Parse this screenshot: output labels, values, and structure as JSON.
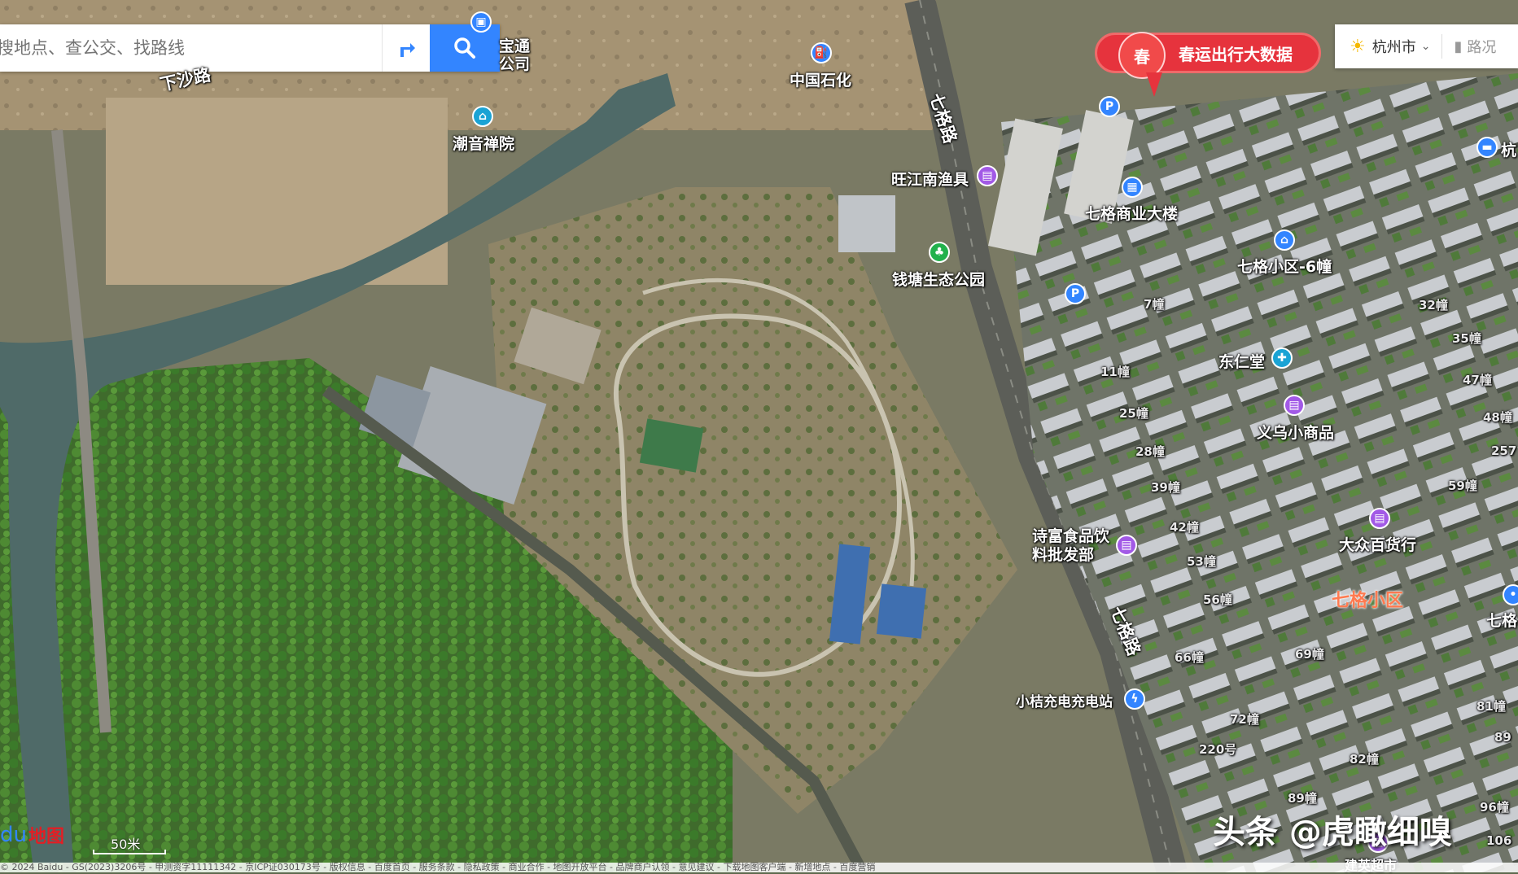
{
  "search": {
    "placeholder": "搜地点、查公交、找路线"
  },
  "banner": {
    "seal": "春",
    "text": "春运出行大数据"
  },
  "citybox": {
    "city": "杭州市",
    "traffic": "路况"
  },
  "roads": [
    {
      "name": "下沙路"
    },
    {
      "name": "七格路"
    },
    {
      "name": "七格路"
    }
  ],
  "pois": [
    {
      "name": "宝通公司",
      "icon": "bus-icon",
      "color": "#3385ff"
    },
    {
      "name": "中国石化",
      "icon": "gas-station-icon",
      "color": "#3385ff"
    },
    {
      "name": "潮音禅院",
      "icon": "temple-icon",
      "color": "#1aa3d4"
    },
    {
      "name": "旺江南渔具",
      "icon": "shop-icon",
      "color": "#a259e6"
    },
    {
      "name": "七格商业大楼",
      "icon": "building-icon",
      "color": "#3385ff"
    },
    {
      "name": "钱塘生态公园",
      "icon": "park-icon",
      "color": "#22b14c"
    },
    {
      "name": "七格小区-6幢",
      "icon": "residence-icon",
      "color": "#3385ff"
    },
    {
      "name": "东仁堂",
      "icon": "pharmacy-icon",
      "color": "#1aa3d4"
    },
    {
      "name": "义乌小商品",
      "icon": "shop-icon",
      "color": "#a259e6"
    },
    {
      "name": "大众百货行",
      "icon": "shop-icon",
      "color": "#a259e6"
    },
    {
      "name": "诗富食品饮料批发部",
      "icon": "shop-icon",
      "color": "#a259e6"
    },
    {
      "name": "小桔充电充电站",
      "icon": "charging-icon",
      "color": "#3385ff"
    },
    {
      "name": "杭",
      "icon": "hotel-icon",
      "color": "#3385ff"
    },
    {
      "name": "七格",
      "icon": "poi-icon",
      "color": "#3385ff"
    },
    {
      "name": "建英超市",
      "icon": "shop-icon",
      "color": "#a259e6"
    }
  ],
  "district": "七格小区",
  "buildings": [
    "7幢",
    "11幢",
    "25幢",
    "28幢",
    "39幢",
    "42幢",
    "53幢",
    "56幢",
    "66幢",
    "69幢",
    "72幢",
    "82幢",
    "89幢",
    "220号",
    "32幢",
    "35幢",
    "47幢",
    "48幢",
    "59幢",
    "81幢",
    "96幢",
    "106",
    "257",
    "89"
  ],
  "parking": [
    "P",
    "P"
  ],
  "scale": "50米",
  "logo": {
    "paw": "du",
    "text": "地图"
  },
  "footer": "© 2024 Baidu - GS(2023)3206号 - 甲测资字11111342 - 京ICP证030173号 - 版权信息 - 百度首页 - 服务条款 - 隐私政策 - 商业合作 - 地图开放平台 - 品牌商户认领 - 意见建议 - 下载地图客户端 - 新增地点 - 百度营销",
  "watermark": "头条 @虎瞰细嗅",
  "colors": {
    "search_btn": "#3385ff",
    "banner": "#e6333d"
  }
}
